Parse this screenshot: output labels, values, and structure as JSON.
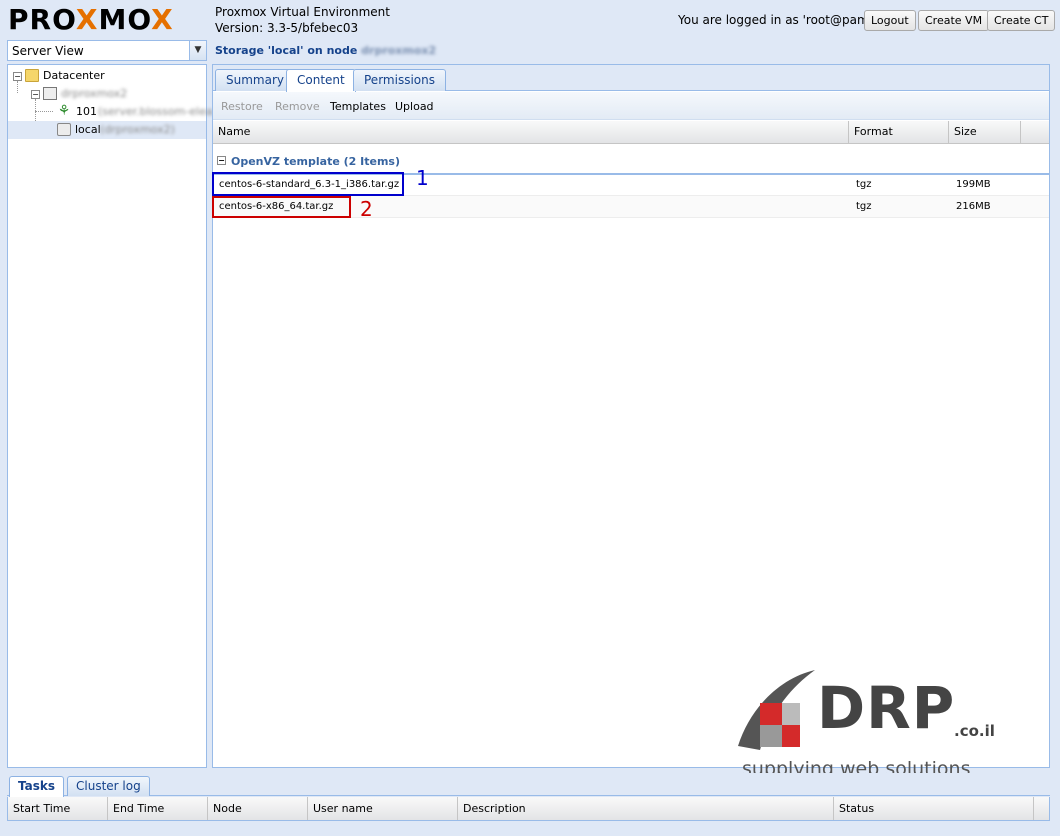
{
  "header": {
    "logo": {
      "part1": "PRO",
      "part2": "X",
      "part3": "MO",
      "part4": "X"
    },
    "app_title": "Proxmox Virtual Environment",
    "version": "Version: 3.3-5/bfebec03",
    "logged_in_text": "You are logged in as 'root@pam'",
    "logout_label": "Logout",
    "create_vm_label": "Create VM",
    "create_ct_label": "Create CT"
  },
  "server_view": {
    "selected": "Server View"
  },
  "storage_title": {
    "prefix": "Storage 'local' on node ",
    "node": "drproxmox2"
  },
  "tree": {
    "datacenter": "Datacenter",
    "node": "drproxmox2",
    "ct_id": "101",
    "ct_name": "(server.blossom-elea...",
    "storage": "local",
    "storage_node": "(drproxmox2)"
  },
  "tabs": [
    {
      "label": "Summary"
    },
    {
      "label": "Content"
    },
    {
      "label": "Permissions"
    }
  ],
  "toolbar": {
    "restore_label": "Restore",
    "remove_label": "Remove",
    "templates_label": "Templates",
    "upload_label": "Upload"
  },
  "grid": {
    "columns": [
      "Name",
      "Format",
      "Size"
    ],
    "group_label": "OpenVZ template (2 Items)",
    "rows": [
      {
        "name": "centos-6-standard_6.3-1_i386.tar.gz",
        "format": "tgz",
        "size": "199MB"
      },
      {
        "name": "centos-6-x86_64.tar.gz",
        "format": "tgz",
        "size": "216MB"
      }
    ]
  },
  "annotations": {
    "label_1": "1",
    "label_2": "2",
    "color_1": "#0000cc",
    "color_2": "#cc0000"
  },
  "watermark": {
    "brand": "DRP",
    "suffix": ".co.il",
    "tagline": "supplying web solutions"
  },
  "bottom": {
    "tabs": [
      {
        "label": "Tasks"
      },
      {
        "label": "Cluster log"
      }
    ],
    "columns": [
      "Start Time",
      "End Time",
      "Node",
      "User name",
      "Description",
      "Status"
    ]
  },
  "colors": {
    "accent": "#e57000",
    "panel_border": "#99bbe8",
    "title_blue": "#15428b"
  }
}
